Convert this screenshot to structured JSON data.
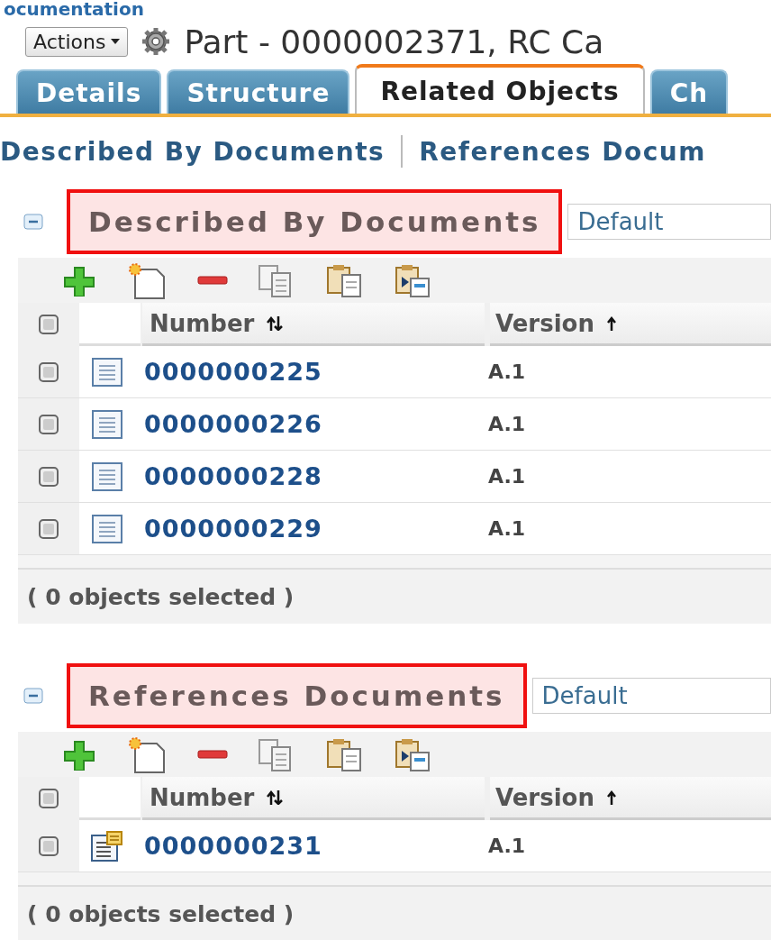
{
  "page_heading": "ocumentation",
  "actions_button": "Actions",
  "title": "Part - 0000002371, RC Ca",
  "tabs": [
    {
      "label": "Details",
      "selected": false
    },
    {
      "label": "Structure",
      "selected": false
    },
    {
      "label": "Related Objects",
      "selected": true
    },
    {
      "label": "Ch",
      "selected": false
    }
  ],
  "section_links": [
    "Described By Documents",
    "References Docum"
  ],
  "tables": [
    {
      "title": "Described By Documents",
      "highlighted": true,
      "expanded": true,
      "view": "Default",
      "all_selected": false,
      "columns": [
        "Number",
        "Version"
      ],
      "rows": [
        {
          "number": "0000000225",
          "version": "A.1",
          "checked": false,
          "kind": "document"
        },
        {
          "number": "0000000226",
          "version": "A.1",
          "checked": false,
          "kind": "document"
        },
        {
          "number": "0000000228",
          "version": "A.1",
          "checked": false,
          "kind": "document"
        },
        {
          "number": "0000000229",
          "version": "A.1",
          "checked": false,
          "kind": "document"
        }
      ],
      "footer": "( 0 objects selected )"
    },
    {
      "title": "References Documents",
      "highlighted": true,
      "expanded": true,
      "view": "Default",
      "all_selected": false,
      "columns": [
        "Number",
        "Version"
      ],
      "rows": [
        {
          "number": "0000000231",
          "version": "A.1",
          "checked": false,
          "kind": "reference"
        }
      ],
      "footer": "( 0 objects selected )"
    }
  ]
}
